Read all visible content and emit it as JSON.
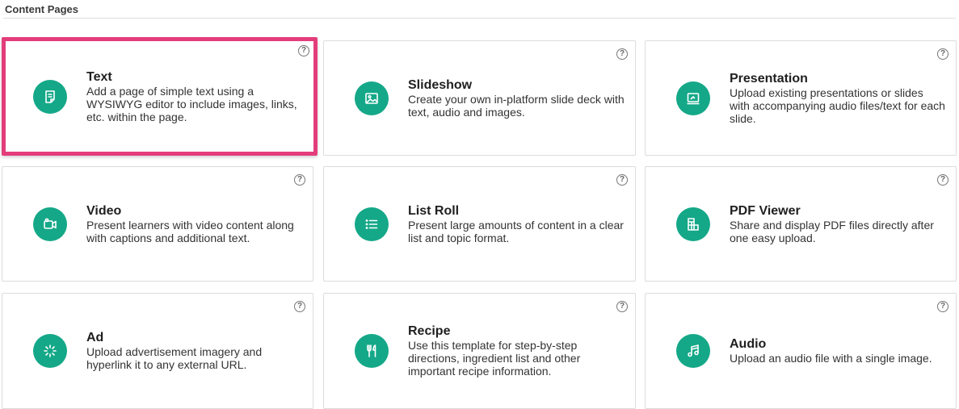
{
  "section": {
    "title": "Content Pages"
  },
  "help_glyph": "?",
  "colors": {
    "accent": "#14a888",
    "selected_border": "#e33d7b"
  },
  "cards": [
    {
      "title": "Text",
      "description": "Add a page of simple text using a WYSIWYG editor to include images, links, etc. within the page.",
      "icon": "text-page-icon",
      "selected": true
    },
    {
      "title": "Slideshow",
      "description": "Create your own in-platform slide deck with text, audio and images.",
      "icon": "image-icon",
      "selected": false
    },
    {
      "title": "Presentation",
      "description": "Upload existing presentations or slides with accompanying audio files/text for each slide.",
      "icon": "presentation-icon",
      "selected": false
    },
    {
      "title": "Video",
      "description": "Present learners with video content along with captions and additional text.",
      "icon": "video-camera-icon",
      "selected": false
    },
    {
      "title": "List Roll",
      "description": "Present large amounts of content in a clear list and topic format.",
      "icon": "list-icon",
      "selected": false
    },
    {
      "title": "PDF Viewer",
      "description": "Share and display PDF files directly after one easy upload.",
      "icon": "pdf-viewer-icon",
      "selected": false
    },
    {
      "title": "Ad",
      "description": "Upload advertisement imagery and hyperlink it to any external URL.",
      "icon": "ad-burst-icon",
      "selected": false
    },
    {
      "title": "Recipe",
      "description": "Use this template for step-by-step directions, ingredient list and other important recipe information.",
      "icon": "fork-knife-icon",
      "selected": false
    },
    {
      "title": "Audio",
      "description": "Upload an audio file with a single image.",
      "icon": "music-note-icon",
      "selected": false
    }
  ]
}
